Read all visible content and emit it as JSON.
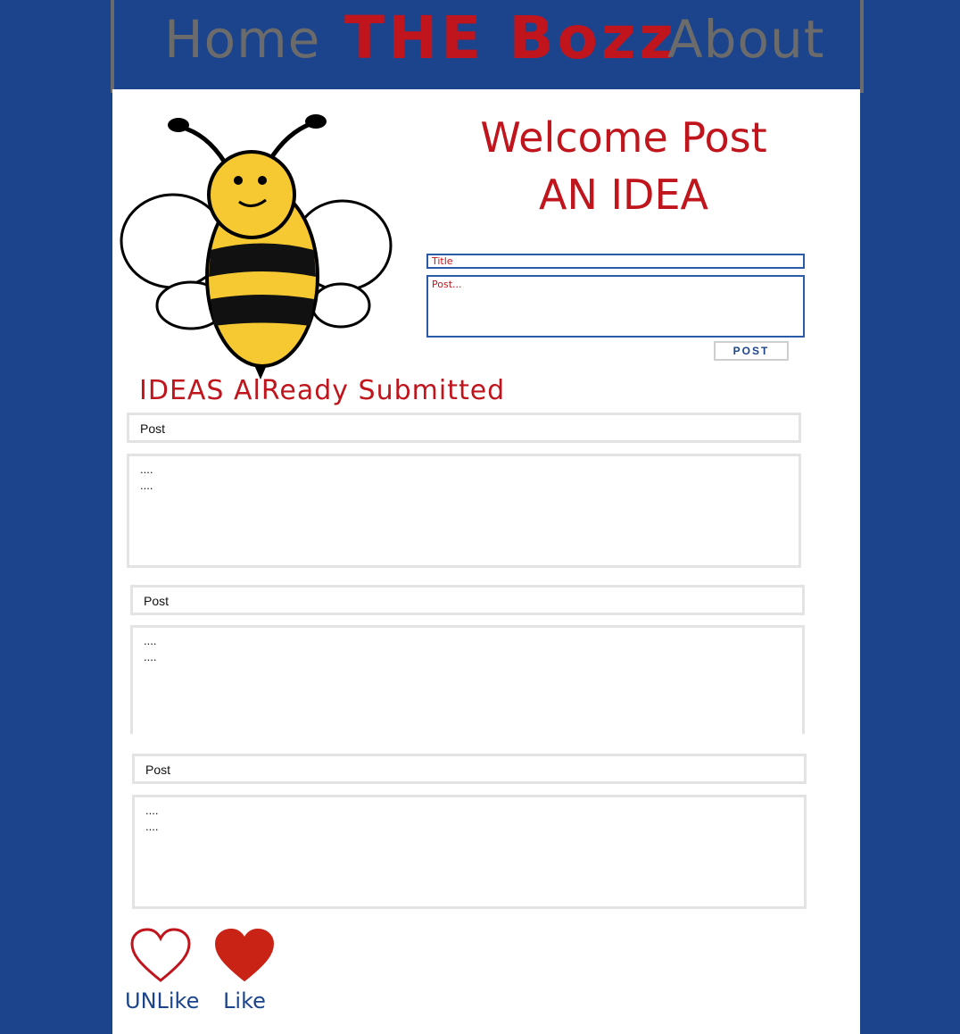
{
  "header": {
    "nav_home": "Home",
    "brand": "THE Bozz",
    "nav_about": "About"
  },
  "colors": {
    "background_blue": "#1c448c",
    "accent_red": "#c0151c",
    "nav_gray": "#6b6b6b",
    "bee_yellow": "#f6c932"
  },
  "hero": {
    "welcome_line1": "Welcome Post",
    "welcome_line2": "AN IDEA",
    "mascot_icon": "bee-icon"
  },
  "form": {
    "title_placeholder": "Title",
    "post_placeholder": "Post...",
    "submit_label": "POST"
  },
  "ideas": {
    "heading": "IDEAS AlReady Submitted",
    "posts": [
      {
        "title": "Post",
        "line1": "....",
        "line2": "...."
      },
      {
        "title": "Post",
        "line1": "....",
        "line2": "...."
      },
      {
        "title": "Post",
        "line1": "....",
        "line2": "...."
      }
    ]
  },
  "reactions": {
    "unlike_label": "UNLike",
    "like_label": "Like",
    "unlike_icon": "heart-outline-icon",
    "like_icon": "heart-filled-icon"
  }
}
